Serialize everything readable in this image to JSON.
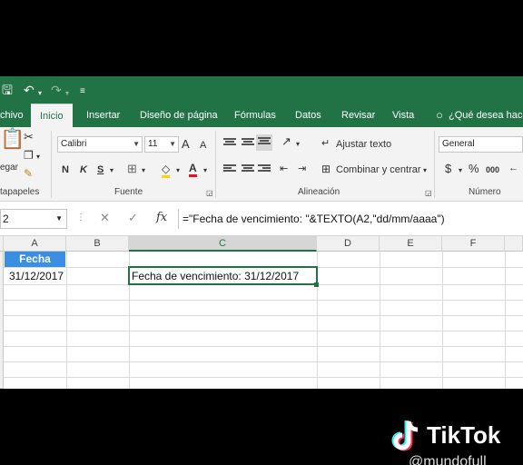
{
  "tabs": [
    "chivo",
    "Inicio",
    "Insertar",
    "Diseño de página",
    "Fórmulas",
    "Datos",
    "Revisar",
    "Vista",
    "¿Qué desea hacer?"
  ],
  "ribbon": {
    "clipboard": {
      "paste_label": "egar",
      "group": "tapapeles"
    },
    "font": {
      "name": "Calibri",
      "size": "11",
      "bold": "N",
      "italic": "K",
      "underline": "S",
      "grow": "A",
      "shrink": "A",
      "color": "A",
      "group": "Fuente"
    },
    "alignment": {
      "wrap": "Ajustar texto",
      "merge": "Combinar y centrar",
      "group": "Alineación"
    },
    "number": {
      "format": "General",
      "currency": "$",
      "percent": "%",
      "thousands": "000",
      "group": "Número"
    }
  },
  "formula_bar": {
    "name_box": "2",
    "cancel": "✕",
    "enter": "✓",
    "fx": "fx",
    "formula": "=\"Fecha de vencimiento: \"&TEXTO(A2,\"dd/mm/aaaa\")"
  },
  "sheet": {
    "columns": [
      "A",
      "B",
      "C",
      "D",
      "E",
      "F"
    ],
    "a1": "Fecha",
    "a2": "31/12/2017",
    "c2": "Fecha de vencimiento: 31/12/2017"
  },
  "watermark": {
    "brand": "TikTok",
    "handle": "@mundofull"
  },
  "colors": {
    "excel_green": "#217346",
    "header_fill": "#3a8fe3"
  }
}
